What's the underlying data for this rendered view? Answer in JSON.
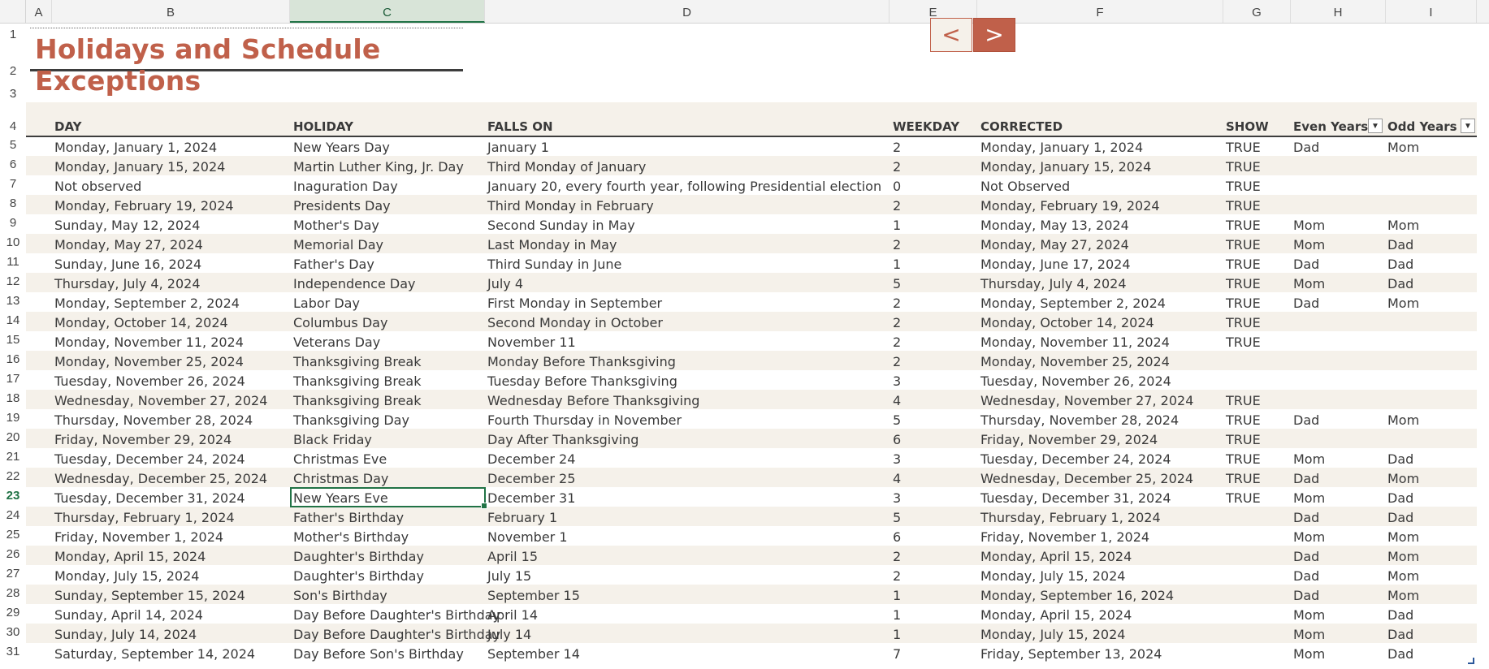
{
  "columns": [
    "A",
    "B",
    "C",
    "D",
    "E",
    "F",
    "G",
    "H",
    "I"
  ],
  "row_numbers": [
    "1",
    "2",
    "3",
    "4",
    "5",
    "6",
    "7",
    "8",
    "9",
    "10",
    "11",
    "12",
    "13",
    "14",
    "15",
    "16",
    "17",
    "18",
    "19",
    "20",
    "21",
    "22",
    "23",
    "24",
    "25",
    "26",
    "27",
    "28",
    "29",
    "30",
    "31"
  ],
  "title": "Holidays and Schedule Exceptions",
  "nav": {
    "prev": "<",
    "next": ">"
  },
  "headers": {
    "day": "DAY",
    "holiday": "HOLIDAY",
    "falls_on": "FALLS ON",
    "weekday": "WEEKDAY",
    "corrected": "CORRECTED",
    "show": "SHOW",
    "even_years": "Even Years",
    "odd_years": "Odd Years"
  },
  "filter_icon": "▼",
  "colors": {
    "accent": "#c0604a",
    "band": "#f5f1ea",
    "selection": "#217346"
  },
  "selected_cell": "C23",
  "rows": [
    [
      "Monday, January 1, 2024",
      "New Years Day",
      "January 1",
      "2",
      "Monday, January 1, 2024",
      "TRUE",
      "Dad",
      "Mom"
    ],
    [
      "Monday, January 15, 2024",
      "Martin Luther King, Jr. Day",
      "Third Monday of January",
      "2",
      "Monday, January 15, 2024",
      "TRUE",
      "",
      ""
    ],
    [
      "Not observed",
      "Inaguration Day",
      "January 20, every fourth year, following Presidential election",
      "0",
      "Not Observed",
      "TRUE",
      "",
      ""
    ],
    [
      "Monday, February 19, 2024",
      "Presidents Day",
      "Third Monday in February",
      "2",
      "Monday, February 19, 2024",
      "TRUE",
      "",
      ""
    ],
    [
      "Sunday, May 12, 2024",
      "Mother's Day",
      "Second Sunday in May",
      "1",
      "Monday, May 13, 2024",
      "TRUE",
      "Mom",
      "Mom"
    ],
    [
      "Monday, May 27, 2024",
      "Memorial Day",
      "Last Monday in May",
      "2",
      "Monday, May 27, 2024",
      "TRUE",
      "Mom",
      "Dad"
    ],
    [
      "Sunday, June 16, 2024",
      "Father's Day",
      "Third Sunday in June",
      "1",
      "Monday, June 17, 2024",
      "TRUE",
      "Dad",
      "Dad"
    ],
    [
      "Thursday, July 4, 2024",
      "Independence Day",
      "July 4",
      "5",
      "Thursday, July 4, 2024",
      "TRUE",
      "Mom",
      "Dad"
    ],
    [
      "Monday, September 2, 2024",
      "Labor Day",
      "First Monday in September",
      "2",
      "Monday, September 2, 2024",
      "TRUE",
      "Dad",
      "Mom"
    ],
    [
      "Monday, October 14, 2024",
      "Columbus Day",
      "Second Monday in October",
      "2",
      "Monday, October 14, 2024",
      "TRUE",
      "",
      ""
    ],
    [
      "Monday, November 11, 2024",
      "Veterans Day",
      "November 11",
      "2",
      "Monday, November 11, 2024",
      "TRUE",
      "",
      ""
    ],
    [
      "Monday, November 25, 2024",
      "Thanksgiving Break",
      "Monday Before Thanksgiving",
      "2",
      "Monday, November 25, 2024",
      "",
      "",
      ""
    ],
    [
      "Tuesday, November 26, 2024",
      "Thanksgiving Break",
      "Tuesday Before Thanksgiving",
      "3",
      "Tuesday, November 26, 2024",
      "",
      "",
      ""
    ],
    [
      "Wednesday, November 27, 2024",
      "Thanksgiving Break",
      "Wednesday Before Thanksgiving",
      "4",
      "Wednesday, November 27, 2024",
      "TRUE",
      "",
      ""
    ],
    [
      "Thursday, November 28, 2024",
      "Thanksgiving Day",
      "Fourth Thursday in November",
      "5",
      "Thursday, November 28, 2024",
      "TRUE",
      "Dad",
      "Mom"
    ],
    [
      "Friday, November 29, 2024",
      "Black Friday",
      "Day After Thanksgiving",
      "6",
      "Friday, November 29, 2024",
      "TRUE",
      "",
      ""
    ],
    [
      "Tuesday, December 24, 2024",
      "Christmas Eve",
      "December 24",
      "3",
      "Tuesday, December 24, 2024",
      "TRUE",
      "Mom",
      "Dad"
    ],
    [
      "Wednesday, December 25, 2024",
      "Christmas Day",
      "December 25",
      "4",
      "Wednesday, December 25, 2024",
      "TRUE",
      "Dad",
      "Mom"
    ],
    [
      "Tuesday, December 31, 2024",
      "New Years Eve",
      "December 31",
      "3",
      "Tuesday, December 31, 2024",
      "TRUE",
      "Mom",
      "Dad"
    ],
    [
      "Thursday, February 1, 2024",
      "Father's Birthday",
      "February 1",
      "5",
      "Thursday, February 1, 2024",
      "",
      "Dad",
      "Dad"
    ],
    [
      "Friday, November 1, 2024",
      "Mother's Birthday",
      "November 1",
      "6",
      "Friday, November 1, 2024",
      "",
      "Mom",
      "Mom"
    ],
    [
      "Monday, April 15, 2024",
      "Daughter's Birthday",
      "April 15",
      "2",
      "Monday, April 15, 2024",
      "",
      "Dad",
      "Mom"
    ],
    [
      "Monday, July 15, 2024",
      "Daughter's Birthday",
      "July 15",
      "2",
      "Monday, July 15, 2024",
      "",
      "Dad",
      "Mom"
    ],
    [
      "Sunday, September 15, 2024",
      "Son's Birthday",
      "September 15",
      "1",
      "Monday, September 16, 2024",
      "",
      "Dad",
      "Mom"
    ],
    [
      "Sunday, April 14, 2024",
      "Day Before Daughter's Birthday",
      "April 14",
      "1",
      "Monday, April 15, 2024",
      "",
      "Mom",
      "Dad"
    ],
    [
      "Sunday, July 14, 2024",
      "Day Before Daughter's Birthday",
      "July 14",
      "1",
      "Monday, July 15, 2024",
      "",
      "Mom",
      "Dad"
    ],
    [
      "Saturday, September 14, 2024",
      "Day Before Son's Birthday",
      "September 14",
      "7",
      "Friday, September 13, 2024",
      "",
      "Mom",
      "Dad"
    ]
  ]
}
